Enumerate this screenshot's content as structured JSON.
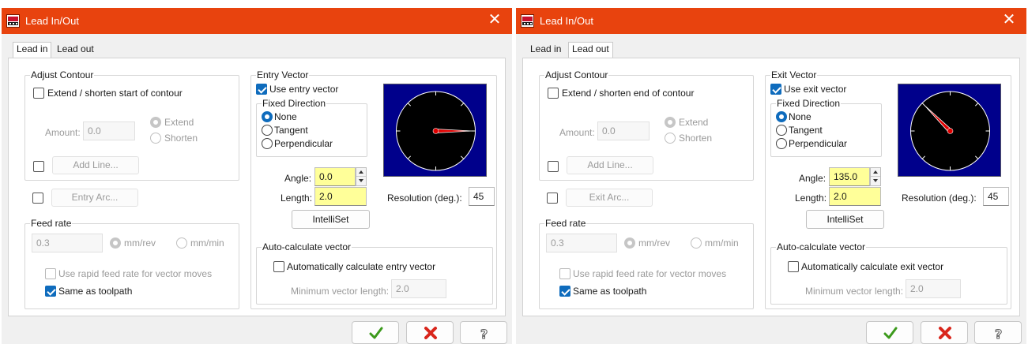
{
  "colors": {
    "titlebar": "#e8430e",
    "accent": "#0f6cbd",
    "dial_bg": "#00008b",
    "highlight_field": "#ffff99",
    "arrow": "#e00000"
  },
  "left": {
    "title": "Lead In/Out",
    "tabs": [
      "Lead in",
      "Lead out"
    ],
    "active_tab": "Lead in",
    "adjust_contour": {
      "title": "Adjust Contour",
      "extend_label": "Extend / shorten start of contour",
      "extend_checked": false,
      "amount_label": "Amount:",
      "amount_value": "0.0",
      "extend_option": "Extend",
      "shorten_option": "Shorten",
      "add_line_label": "Add Line..."
    },
    "arc": {
      "label": "Entry Arc..."
    },
    "feed_rate": {
      "title": "Feed rate",
      "value": "0.3",
      "unit_rev": "mm/rev",
      "unit_min": "mm/min",
      "rapid_label": "Use rapid feed rate for vector moves",
      "same_label": "Same as toolpath",
      "same_checked": true
    },
    "vector": {
      "title": "Entry Vector",
      "use_label": "Use entry vector",
      "use_checked": true,
      "fixed_title": "Fixed Direction",
      "options": [
        "None",
        "Tangent",
        "Perpendicular"
      ],
      "selected_option": "None",
      "angle_label": "Angle:",
      "angle_value": "0.0",
      "length_label": "Length:",
      "length_value": "2.0",
      "resolution_label": "Resolution (deg.):",
      "resolution_value": "45",
      "intelliset_label": "IntelliSet",
      "dial_angle_deg": 0
    },
    "auto_calc": {
      "title": "Auto-calculate vector",
      "label": "Automatically calculate entry vector",
      "checked": false,
      "min_label": "Minimum vector length:",
      "min_value": "2.0"
    }
  },
  "right": {
    "title": "Lead In/Out",
    "tabs": [
      "Lead in",
      "Lead out"
    ],
    "active_tab": "Lead out",
    "adjust_contour": {
      "title": "Adjust Contour",
      "extend_label": "Extend / shorten end of contour",
      "extend_checked": false,
      "amount_label": "Amount:",
      "amount_value": "0.0",
      "extend_option": "Extend",
      "shorten_option": "Shorten",
      "add_line_label": "Add Line..."
    },
    "arc": {
      "label": "Exit Arc..."
    },
    "feed_rate": {
      "title": "Feed rate",
      "value": "0.3",
      "unit_rev": "mm/rev",
      "unit_min": "mm/min",
      "rapid_label": "Use rapid feed rate for vector moves",
      "same_label": "Same as toolpath",
      "same_checked": true
    },
    "vector": {
      "title": "Exit Vector",
      "use_label": "Use exit vector",
      "use_checked": true,
      "fixed_title": "Fixed Direction",
      "options": [
        "None",
        "Tangent",
        "Perpendicular"
      ],
      "selected_option": "None",
      "angle_label": "Angle:",
      "angle_value": "135.0",
      "length_label": "Length:",
      "length_value": "2.0",
      "resolution_label": "Resolution (deg.):",
      "resolution_value": "45",
      "intelliset_label": "IntelliSet",
      "dial_angle_deg": 135
    },
    "auto_calc": {
      "title": "Auto-calculate vector",
      "label": "Automatically calculate exit vector",
      "checked": false,
      "min_label": "Minimum vector length:",
      "min_value": "2.0"
    }
  },
  "footer": {
    "ok_icon": "check-icon",
    "cancel_icon": "cross-icon",
    "help_icon": "help-icon"
  }
}
